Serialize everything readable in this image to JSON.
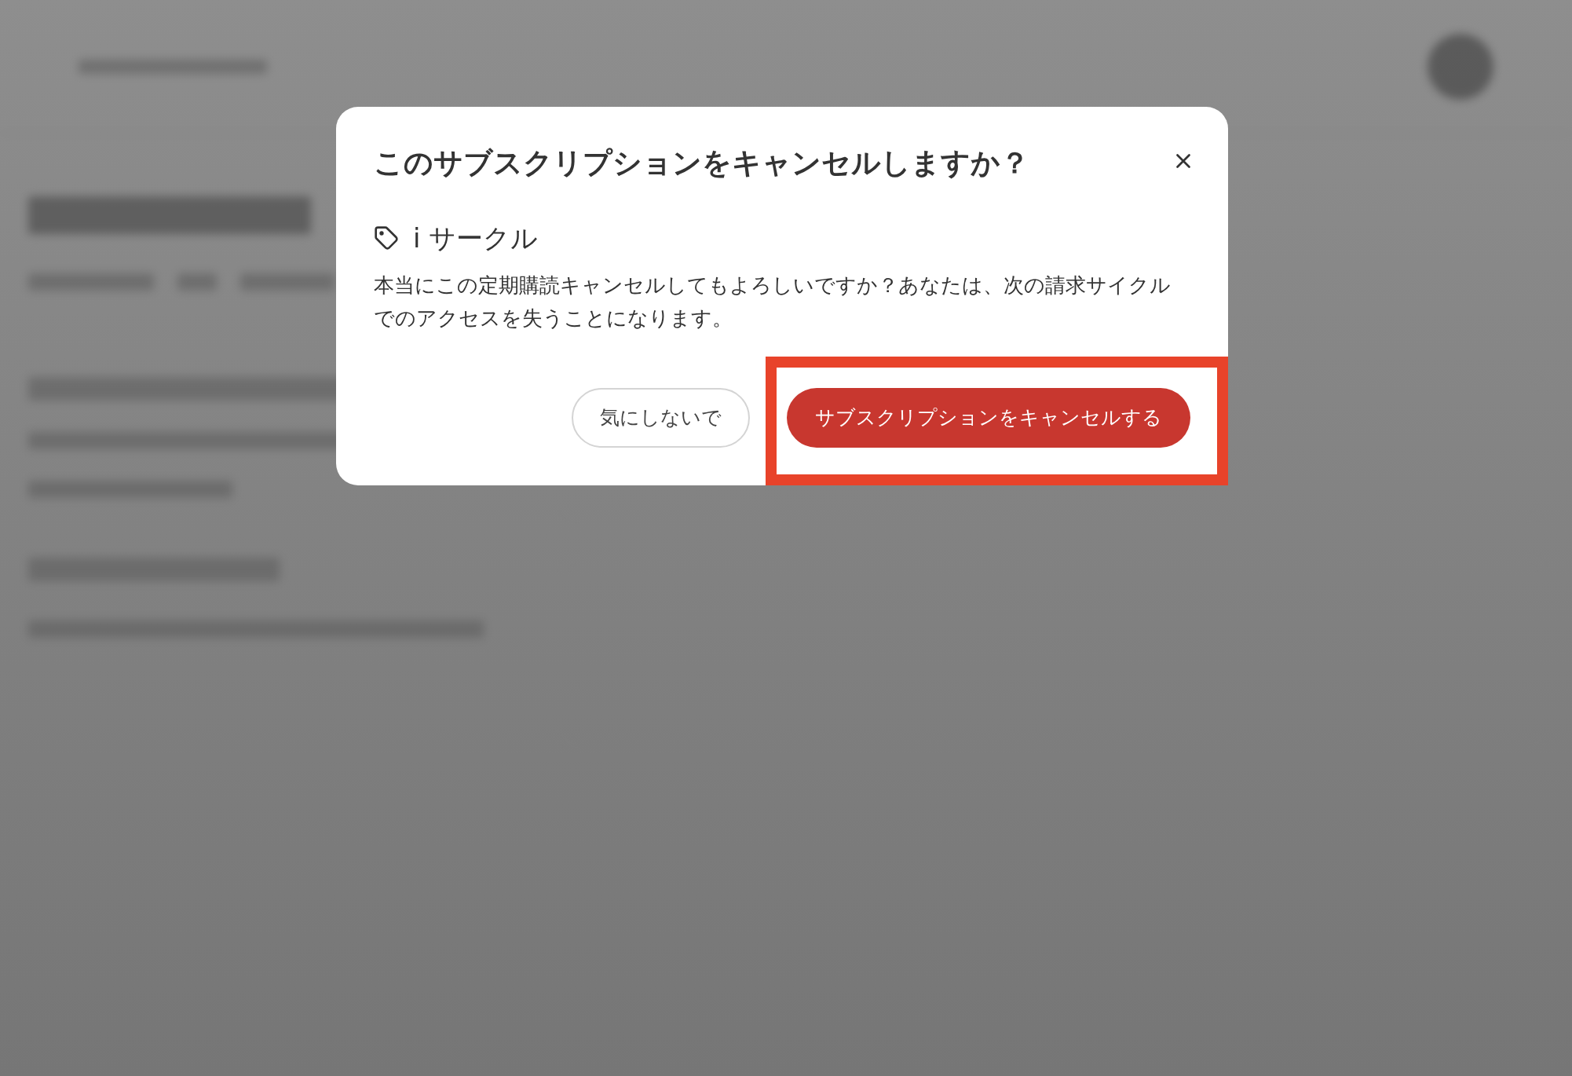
{
  "dialog": {
    "title": "このサブスクリプションをキャンセルしますか？",
    "product_name": "i サークル",
    "message": "本当にこの定期購読キャンセルしてもよろしいですか？あなたは、次の請求サイクルでのアクセスを失うことになります。",
    "buttons": [
      {
        "label": "気にしないで",
        "kind": "secondary",
        "highlighted": false
      },
      {
        "label": "サブスクリプションをキャンセルする",
        "kind": "danger",
        "highlighted": true
      }
    ]
  }
}
